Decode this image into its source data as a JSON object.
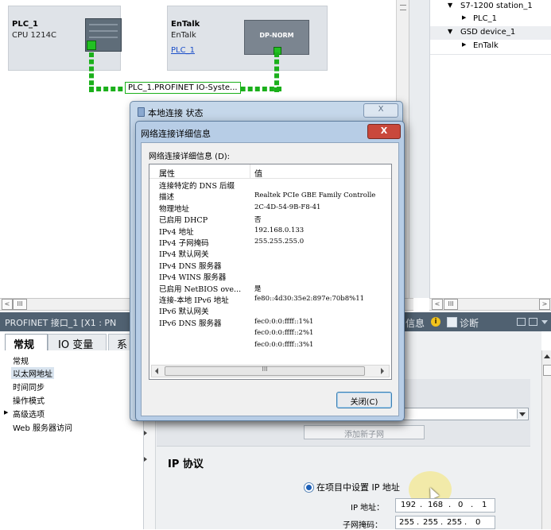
{
  "network_view": {
    "devices": [
      {
        "name": "PLC_1",
        "type": "CPU 1214C"
      },
      {
        "name": "EnTalk",
        "type": "EnTalk",
        "link": "PLC_1",
        "module_label": "DP-NORM"
      }
    ],
    "network_label": "PLC_1.PROFINET IO-Syste..."
  },
  "project_tree": {
    "items": [
      {
        "label": "S7-1200 station_1",
        "arrow": "▼"
      },
      {
        "label": "PLC_1",
        "arrow": "▶"
      },
      {
        "label": "GSD device_1",
        "arrow": "▼"
      },
      {
        "label": "EnTalk",
        "arrow": "▶"
      }
    ]
  },
  "scrollbars": {
    "left_arrow": "<",
    "thumb": "III",
    "right_arrow": ">"
  },
  "properties": {
    "header_title": "PROFINET 接口_1 [X1 : PN",
    "right_tabs": [
      {
        "label": "信息",
        "icon": "info-icon"
      },
      {
        "label": "诊断",
        "icon": "diagnostics-icon"
      }
    ],
    "tabs": [
      "常规",
      "IO 变量",
      "系"
    ],
    "nav_items": [
      "常规",
      "以太网地址",
      "时间同步",
      "操作模式",
      "高级选项",
      "Web 服务器访问"
    ],
    "nav_expand_marker": "▶",
    "add_subnet_button": "添加新子网",
    "ip_section_title": "IP 协议",
    "ip_radio_label": "在项目中设置 IP 地址",
    "ip_address_label": "IP 地址：",
    "ip_address": [
      "192",
      "168",
      "0",
      "1"
    ],
    "subnet_mask_label": "子网掩码：",
    "subnet_mask": [
      "255",
      "255",
      "255",
      "0"
    ]
  },
  "outer_dialog": {
    "title": "本地连接 状态"
  },
  "inner_dialog": {
    "title": "网络连接详细信息",
    "list_label": "网络连接详细信息 (D):",
    "columns": [
      "属性",
      "值"
    ],
    "rows": [
      {
        "prop": "连接特定的 DNS 后缀",
        "val": ""
      },
      {
        "prop": "描述",
        "val": "Realtek PCIe GBE Family Controlle"
      },
      {
        "prop": "物理地址",
        "val": "2C-4D-54-9B-F8-41"
      },
      {
        "prop": "已启用 DHCP",
        "val": "否"
      },
      {
        "prop": "IPv4 地址",
        "val": "192.168.0.133"
      },
      {
        "prop": "IPv4 子网掩码",
        "val": "255.255.255.0"
      },
      {
        "prop": "IPv4 默认网关",
        "val": ""
      },
      {
        "prop": "IPv4 DNS 服务器",
        "val": ""
      },
      {
        "prop": "IPv4 WINS 服务器",
        "val": ""
      },
      {
        "prop": "已启用 NetBIOS ove...",
        "val": "是"
      },
      {
        "prop": "连接-本地 IPv6 地址",
        "val": "fe80::4d30:35e2:897e:70b8%11"
      },
      {
        "prop": "IPv6 默认网关",
        "val": ""
      },
      {
        "prop": "IPv6 DNS 服务器",
        "val": "fec0:0:0:ffff::1%1"
      },
      {
        "prop": "",
        "val": "fec0:0:0:ffff::2%1"
      },
      {
        "prop": "",
        "val": "fec0:0:0:ffff::3%1"
      }
    ],
    "hscroll_thumb": "III",
    "close_button": "关闭(C)",
    "close_x": "X"
  },
  "colors": {
    "network_green": "#1bb01b",
    "dialog_frame": "#b7cde6",
    "close_red": "#c9483b",
    "header_bar": "#506171"
  }
}
